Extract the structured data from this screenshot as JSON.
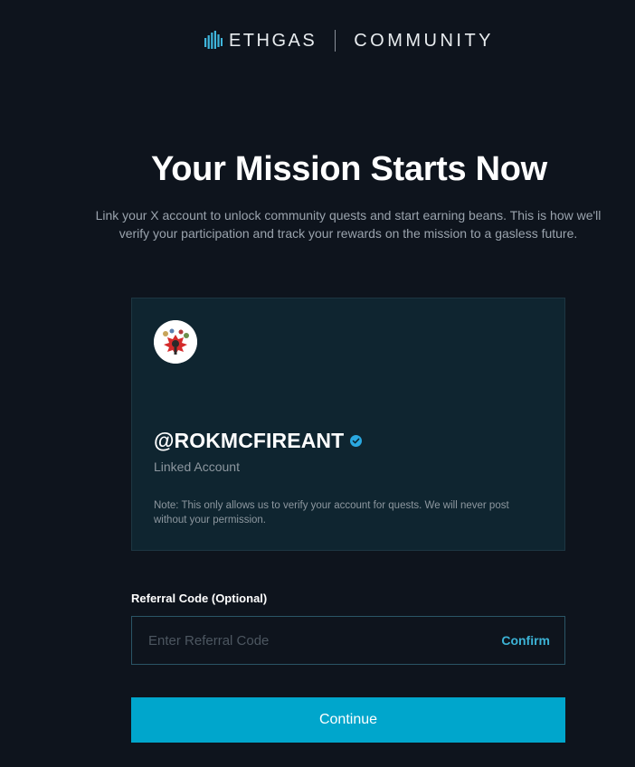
{
  "header": {
    "brand_name": "ETHGAS",
    "section": "COMMUNITY",
    "logo_icon": "ethgas-bars-logo-icon"
  },
  "hero": {
    "title": "Your Mission Starts Now",
    "subtitle": "Link your X account to unlock community quests and start earning beans. This is how we'll verify your participation and track your rewards on the mission to a gasless future."
  },
  "account_card": {
    "avatar_icon": "user-avatar-icon",
    "handle": "@ROKMCFIREANT",
    "verified_icon": "verified-check-icon",
    "status": "Linked Account",
    "note": "Note: This only allows us to verify your account for quests. We will never post without your permission."
  },
  "referral": {
    "label": "Referral Code (Optional)",
    "value": "",
    "placeholder": "Enter Referral Code",
    "confirm_label": "Confirm"
  },
  "actions": {
    "continue_label": "Continue"
  },
  "colors": {
    "background": "#0e141d",
    "card": "#0f2530",
    "accent": "#00a6cc",
    "link": "#3cb3d6",
    "verified": "#2aa8e0"
  }
}
